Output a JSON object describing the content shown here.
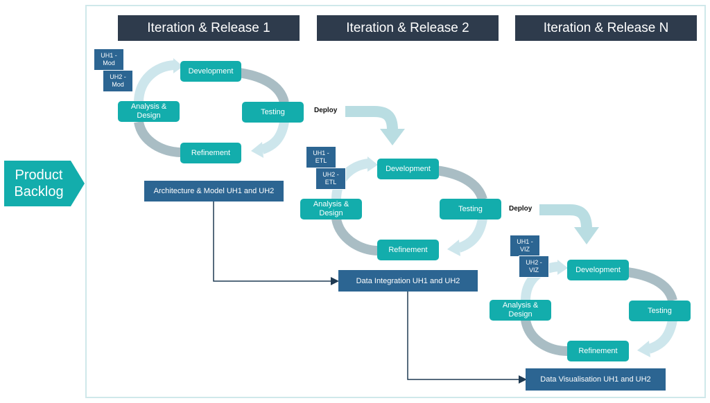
{
  "product_backlog": {
    "line1": "Product",
    "line2": "Backlog"
  },
  "iterations": [
    {
      "header": "Iteration & Release 1",
      "cycle": {
        "top": "Development",
        "right": "Testing",
        "bottom": "Refinement",
        "left_line1": "Analysis &",
        "left_line2": "Design"
      },
      "user_stories": [
        {
          "line1": "UH1 -",
          "line2": "Mod"
        },
        {
          "line1": "UH2 -",
          "line2": "Mod"
        }
      ],
      "phase": "Architecture & Model UH1 and UH2",
      "deploy_label": "Deploy"
    },
    {
      "header": "Iteration & Release 2",
      "cycle": {
        "top": "Development",
        "right": "Testing",
        "bottom": "Refinement",
        "left_line1": "Analysis &",
        "left_line2": "Design"
      },
      "user_stories": [
        {
          "line1": "UH1 -",
          "line2": "ETL"
        },
        {
          "line1": "UH2 -",
          "line2": "ETL"
        }
      ],
      "phase": "Data Integration UH1 and UH2",
      "deploy_label": "Deploy"
    },
    {
      "header": "Iteration & Release N",
      "cycle": {
        "top": "Development",
        "right": "Testing",
        "bottom": "Refinement",
        "left_line1": "Analysis &",
        "left_line2": "Design"
      },
      "user_stories": [
        {
          "line1": "UH1 -",
          "line2": "VIZ"
        },
        {
          "line1": "UH2 -",
          "line2": "VIZ"
        }
      ],
      "phase": "Data Visualisation UH1 and UH2"
    }
  ],
  "colors": {
    "teal": "#13adac",
    "navy_header": "#2e3b4c",
    "story_blue": "#2c6592",
    "arrow_light": "#cde6ec",
    "arrow_grey": "#a9bdc4",
    "connector": "#1f3a52"
  }
}
